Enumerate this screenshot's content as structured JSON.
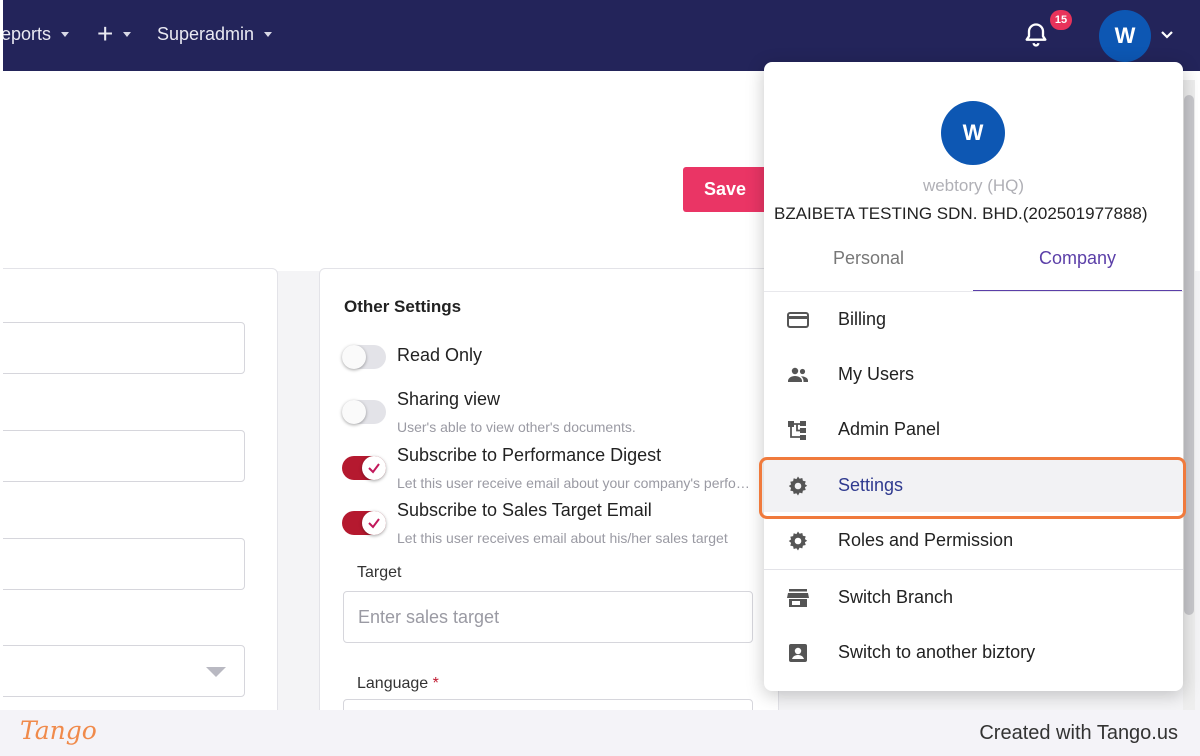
{
  "topnav": {
    "reports_label": "Reports",
    "add_label": "+",
    "superadmin_label": "Superadmin",
    "notification_count": "15",
    "avatar_initial": "W"
  },
  "page": {
    "save_label": "Save"
  },
  "other_settings": {
    "title": "Other Settings",
    "toggles": [
      {
        "label": "Read Only",
        "sub": "",
        "on": false
      },
      {
        "label": "Sharing view",
        "sub": "User's able to view other's documents.",
        "on": false
      },
      {
        "label": "Subscribe to Performance Digest",
        "sub": "Let this user receive email about your company's performance digest",
        "on": true
      },
      {
        "label": "Subscribe to Sales Target Email",
        "sub": "Let this user receives email about his/her sales target",
        "on": true
      }
    ],
    "target_label": "Target",
    "target_placeholder": "Enter sales target",
    "language_label": "Language",
    "required_mark": "*"
  },
  "account_menu": {
    "avatar_initial": "W",
    "branch": "webtory (HQ)",
    "company": "BZAIBETA TESTING SDN. BHD.(202501977888)",
    "tabs": [
      {
        "label": "Personal",
        "active": false
      },
      {
        "label": "Company",
        "active": true
      }
    ],
    "items": [
      {
        "label": "Billing",
        "icon": "credit-card-icon"
      },
      {
        "label": "My Users",
        "icon": "users-icon"
      },
      {
        "label": "Admin Panel",
        "icon": "hierarchy-icon"
      },
      {
        "label": "Settings",
        "icon": "gear-icon"
      },
      {
        "label": "Roles and Permission",
        "icon": "gear-icon"
      },
      {
        "label": "Switch Branch",
        "icon": "store-icon"
      },
      {
        "label": "Switch to another biztory",
        "icon": "account-box-icon"
      }
    ]
  },
  "footer": {
    "logo": "Tango",
    "credit": "Created with Tango.us"
  },
  "colors": {
    "topbar": "#23245a",
    "accent": "#ea3565",
    "toggle_on": "#b5192f",
    "tab_active": "#5b3fa8",
    "highlight": "#f07a3c"
  }
}
